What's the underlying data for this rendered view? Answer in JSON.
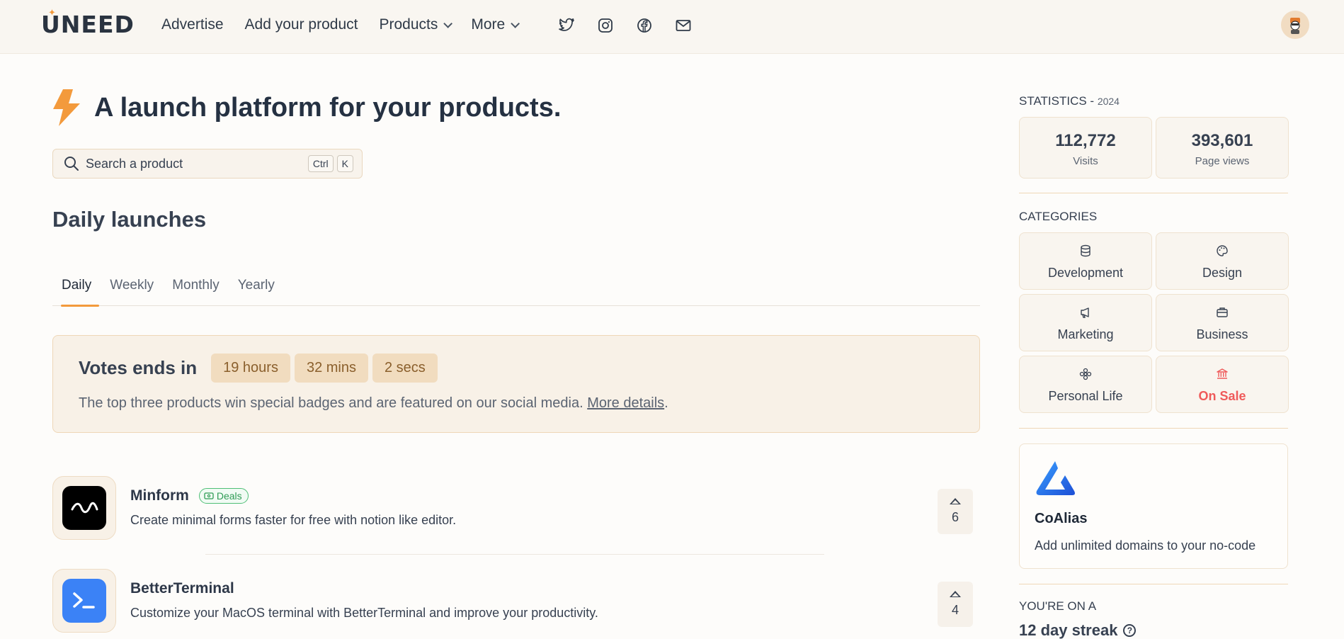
{
  "header": {
    "logo_text": "UNEED",
    "nav": [
      {
        "label": "Advertise"
      },
      {
        "label": "Add your product"
      },
      {
        "label": "Products"
      },
      {
        "label": "More"
      }
    ],
    "social_icons": [
      "twitter-icon",
      "instagram-icon",
      "facebook-icon",
      "mail-icon"
    ]
  },
  "hero": {
    "title": "A launch platform for your products.",
    "search_placeholder": "Search a product",
    "shortcut": [
      "Ctrl",
      "K"
    ]
  },
  "launches": {
    "title": "Daily launches",
    "tabs": [
      "Daily",
      "Weekly",
      "Monthly",
      "Yearly"
    ],
    "active_tab": "Daily",
    "votes": {
      "title": "Votes ends in",
      "hours": "19 hours",
      "mins": "32 mins",
      "secs": "2 secs",
      "text": "The top three products win special badges and are featured on our social media.",
      "link": "More details",
      "link_suffix": "."
    },
    "products": [
      {
        "name": "Minform",
        "badge": "Deals",
        "description": "Create minimal forms faster for free with notion like editor.",
        "votes": "6",
        "logo_color": "#000000"
      },
      {
        "name": "BetterTerminal",
        "badge": "",
        "description": "Customize your MacOS terminal with BetterTerminal and improve your productivity.",
        "votes": "4",
        "logo_color": "#3b82f6"
      }
    ]
  },
  "sidebar": {
    "statistics_label": "STATISTICS -",
    "statistics_year": "2024",
    "stats": [
      {
        "value": "112,772",
        "label": "Visits"
      },
      {
        "value": "393,601",
        "label": "Page views"
      }
    ],
    "categories_label": "CATEGORIES",
    "categories": [
      {
        "label": "Development",
        "icon": "database-icon"
      },
      {
        "label": "Design",
        "icon": "palette-icon"
      },
      {
        "label": "Marketing",
        "icon": "megaphone-icon"
      },
      {
        "label": "Business",
        "icon": "briefcase-icon"
      },
      {
        "label": "Personal Life",
        "icon": "flower-icon"
      },
      {
        "label": "On Sale",
        "icon": "bank-icon"
      }
    ],
    "ad": {
      "title": "CoAlias",
      "description": "Add unlimited domains to your no-code"
    },
    "streak_label": "YOU'RE ON A",
    "streak": "12 day streak"
  },
  "colors": {
    "accent": "#f39a3c",
    "sale": "#ef5a5a",
    "deal": "#2f9c55"
  }
}
